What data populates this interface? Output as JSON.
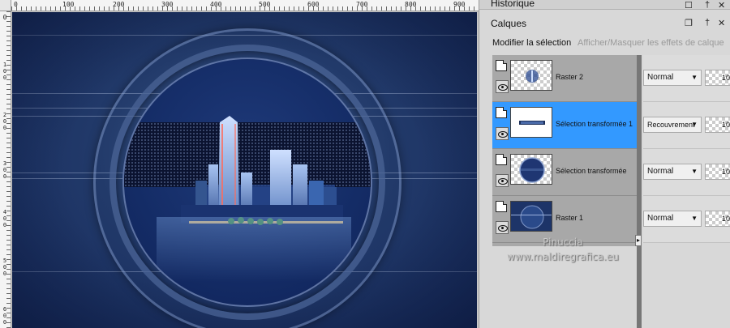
{
  "ruler": {
    "top_labels": [
      "0",
      "100",
      "200",
      "300",
      "400",
      "500",
      "600",
      "700",
      "800",
      "900"
    ],
    "left_labels": [
      "0",
      "100",
      "200",
      "300",
      "400",
      "500",
      "600"
    ]
  },
  "panels": {
    "history_title": "Historique",
    "layers_title": "Calques",
    "toolbar": {
      "modify_selection": "Modifier la sélection",
      "toggle_effects": "Afficher/Masquer les effets de calque"
    },
    "layers": [
      {
        "name": "Raster 2",
        "blend": "Normal",
        "opacity": "10",
        "selected": false
      },
      {
        "name": "Sélection transformée 1",
        "blend": "Recouvrement",
        "opacity": "10",
        "selected": true
      },
      {
        "name": "Sélection transformée",
        "blend": "Normal",
        "opacity": "10",
        "selected": false
      },
      {
        "name": "Raster 1",
        "blend": "Normal",
        "opacity": "10",
        "selected": false
      }
    ]
  },
  "watermark": {
    "line1": "Pinuccia",
    "line2": "www.maldiregrafica.eu"
  },
  "colors": {
    "selection": "#3399ff",
    "canvas_bg": "#14285a"
  }
}
